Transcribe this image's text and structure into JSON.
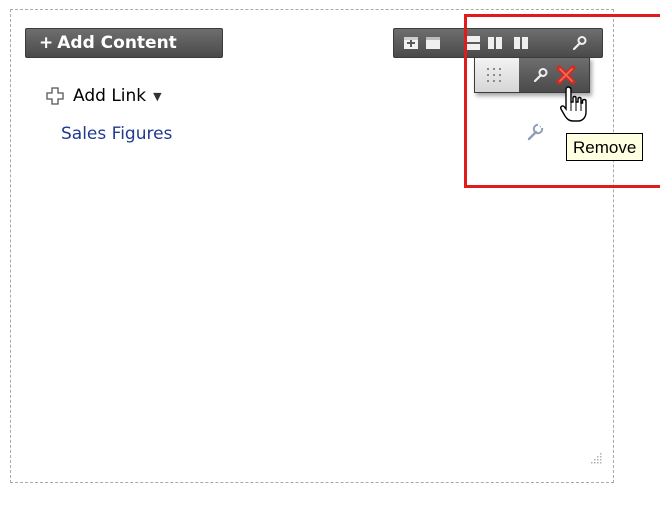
{
  "add_content": {
    "plus": "+",
    "label": "Add Content"
  },
  "add_link": {
    "label": "Add Link"
  },
  "links": [
    {
      "label": "Sales Figures"
    }
  ],
  "tooltip": {
    "text": "Remove"
  },
  "icons": {
    "toolbar": [
      "add-box-icon",
      "layout-one-column-icon",
      "layout-stacked-icon",
      "layout-two-column-icon",
      "layout-three-column-icon",
      "wrench-icon"
    ],
    "popup": [
      "drag-grip-icon",
      "wrench-icon",
      "remove-x-icon"
    ],
    "cursor": "hand-pointer-icon"
  },
  "colors": {
    "button_bg": "#5a5a5a",
    "link": "#1f3a8f",
    "highlight": "#e01b1b",
    "tooltip_bg": "#ffffe1",
    "remove_icon": "#d42b1e"
  }
}
